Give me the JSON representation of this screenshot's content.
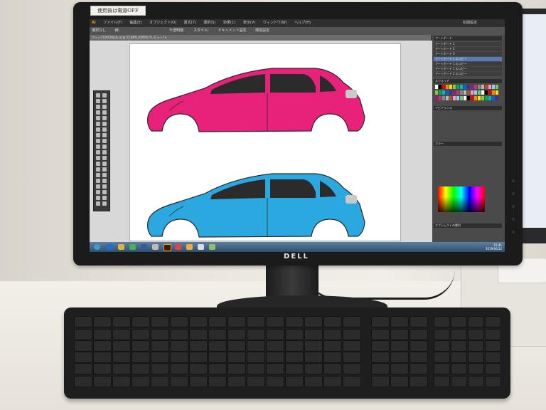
{
  "scene": {
    "sticker_text": "使用後は電源OFF",
    "brand": "DELL"
  },
  "app": {
    "icon": "Ai",
    "menu": [
      "ファイル(F)",
      "編集(E)",
      "オブジェクト(O)",
      "書式(T)",
      "選択(S)",
      "効果(C)",
      "表示(V)",
      "ウィンドウ(W)",
      "ヘルプ(H)"
    ],
    "control_bar": [
      "選択なし",
      "線:",
      "不透明度:",
      "スタイル:",
      "ドキュメント設定",
      "環境設定"
    ],
    "doc_tab": "ヴィッツ(2014年)左.ai @ 55.86% (CMYK/プレビュー) ×",
    "workspace": "初期設定"
  },
  "panels": {
    "artboards_title": "アートボード",
    "artboards": [
      "アートボード 1",
      "アートボード 2",
      "アートボード 3",
      "アートボード 1 のコピー",
      "アートボード 1 のコピー",
      "アートボード 1 のコピー",
      "アートボード 2 のコピー"
    ],
    "swatches_title": "スウォッチ",
    "color_title": "カラー",
    "appearance_title": "アピアランス",
    "object_title": "オブジェクトの整列"
  },
  "artwork": {
    "car_top_color": "#e8217a",
    "car_bottom_color": "#2ba8df",
    "outline_color": "#2a2a2a",
    "window_color": "#2b2b2b",
    "light_color": "#c9c9c9"
  },
  "taskbar": {
    "time": "15:41",
    "date": "2019/06/12"
  }
}
